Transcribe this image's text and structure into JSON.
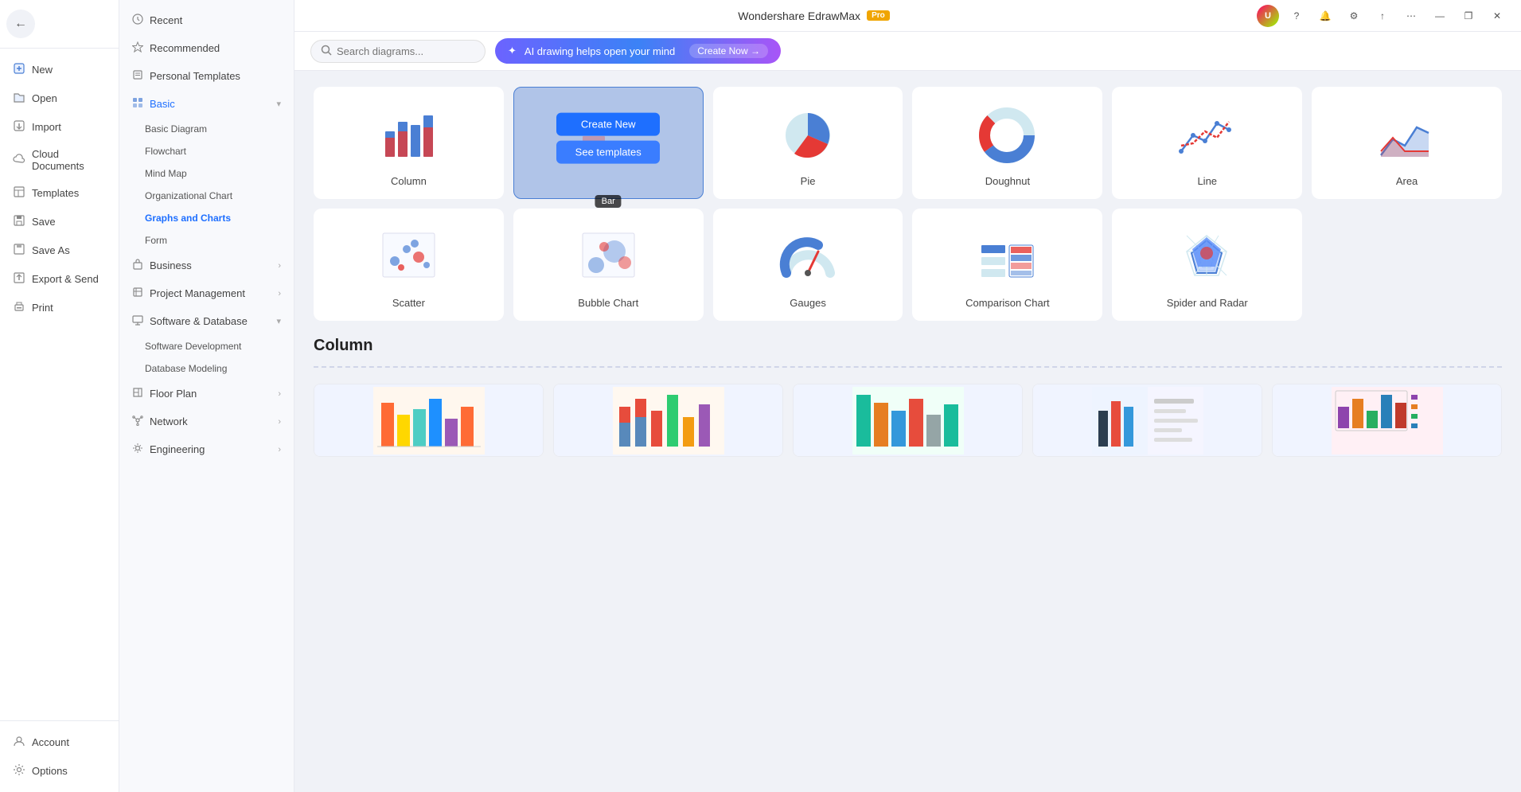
{
  "app": {
    "title": "Wondershare EdrawMax",
    "pro_badge": "Pro"
  },
  "window_controls": {
    "minimize": "—",
    "maximize": "❐",
    "close": "✕"
  },
  "sidebar": {
    "back_label": "←",
    "items": [
      {
        "id": "new",
        "icon": "➕",
        "label": "New"
      },
      {
        "id": "open",
        "icon": "📂",
        "label": "Open"
      },
      {
        "id": "import",
        "icon": "📥",
        "label": "Import"
      },
      {
        "id": "cloud",
        "icon": "☁️",
        "label": "Cloud Documents"
      },
      {
        "id": "templates",
        "icon": "📋",
        "label": "Templates"
      },
      {
        "id": "save",
        "icon": "💾",
        "label": "Save"
      },
      {
        "id": "saveas",
        "icon": "💾",
        "label": "Save As"
      },
      {
        "id": "export",
        "icon": "📤",
        "label": "Export & Send"
      },
      {
        "id": "print",
        "icon": "🖨️",
        "label": "Print"
      }
    ],
    "bottom_items": [
      {
        "id": "account",
        "icon": "👤",
        "label": "Account"
      },
      {
        "id": "options",
        "icon": "⚙️",
        "label": "Options"
      }
    ]
  },
  "nav": {
    "items": [
      {
        "id": "recent",
        "icon": "🕐",
        "label": "Recent",
        "has_arrow": false
      },
      {
        "id": "recommended",
        "icon": "⭐",
        "label": "Recommended",
        "has_arrow": false
      },
      {
        "id": "personal",
        "icon": "📄",
        "label": "Personal Templates",
        "has_arrow": false
      },
      {
        "id": "basic",
        "icon": "◈",
        "label": "Basic",
        "has_arrow": true,
        "active": true,
        "sub_items": [
          "Basic Diagram",
          "Flowchart",
          "Mind Map",
          "Organizational Chart",
          "Graphs and Charts",
          "Form"
        ]
      },
      {
        "id": "business",
        "icon": "💼",
        "label": "Business",
        "has_arrow": true
      },
      {
        "id": "project",
        "icon": "📊",
        "label": "Project Management",
        "has_arrow": true
      },
      {
        "id": "software",
        "icon": "🖥️",
        "label": "Software & Database",
        "has_arrow": true,
        "sub_items": [
          "Software Development",
          "Database Modeling"
        ]
      },
      {
        "id": "floorplan",
        "icon": "🏠",
        "label": "Floor Plan",
        "has_arrow": true
      },
      {
        "id": "network",
        "icon": "🌐",
        "label": "Network",
        "has_arrow": true
      },
      {
        "id": "engineering",
        "icon": "⚙️",
        "label": "Engineering",
        "has_arrow": true
      }
    ],
    "active_sub": "Graphs and Charts"
  },
  "toolbar": {
    "search_placeholder": "Search diagrams...",
    "ai_banner_text": "AI drawing helps open your mind",
    "ai_banner_cta": "Create Now →"
  },
  "charts": [
    {
      "id": "column",
      "label": "Column",
      "hovered": false
    },
    {
      "id": "bar",
      "label": "Bar",
      "hovered": true,
      "tooltip": "Bar"
    },
    {
      "id": "pie",
      "label": "Pie",
      "hovered": false
    },
    {
      "id": "doughnut",
      "label": "Doughnut",
      "hovered": false
    },
    {
      "id": "line",
      "label": "Line",
      "hovered": false
    },
    {
      "id": "area",
      "label": "Area",
      "hovered": false
    },
    {
      "id": "scatter",
      "label": "Scatter",
      "hovered": false
    },
    {
      "id": "bubble",
      "label": "Bubble Chart",
      "hovered": false
    },
    {
      "id": "gauges",
      "label": "Gauges",
      "hovered": false
    },
    {
      "id": "comparison",
      "label": "Comparison Chart",
      "hovered": false
    },
    {
      "id": "spider",
      "label": "Spider and Radar",
      "hovered": false
    }
  ],
  "hover_buttons": {
    "create_new": "Create New",
    "see_templates": "See templates"
  },
  "section": {
    "title": "Column"
  },
  "templates": [
    {
      "id": "t1",
      "colors": [
        "#ff6b35",
        "#ffd700",
        "#4ecdc4",
        "#1e90ff",
        "#9b59b6"
      ]
    },
    {
      "id": "t2",
      "colors": [
        "#e74c3c",
        "#3498db",
        "#2ecc71",
        "#f39c12",
        "#9b59b6"
      ]
    },
    {
      "id": "t3",
      "colors": [
        "#1abc9c",
        "#e67e22",
        "#3498db",
        "#e74c3c",
        "#95a5a6"
      ]
    },
    {
      "id": "t4",
      "colors": [
        "#2c3e50",
        "#e74c3c",
        "#3498db",
        "#f1c40f",
        "#1abc9c"
      ]
    },
    {
      "id": "t5",
      "colors": [
        "#8e44ad",
        "#e67e22",
        "#27ae60",
        "#2980b9",
        "#c0392b"
      ]
    }
  ]
}
